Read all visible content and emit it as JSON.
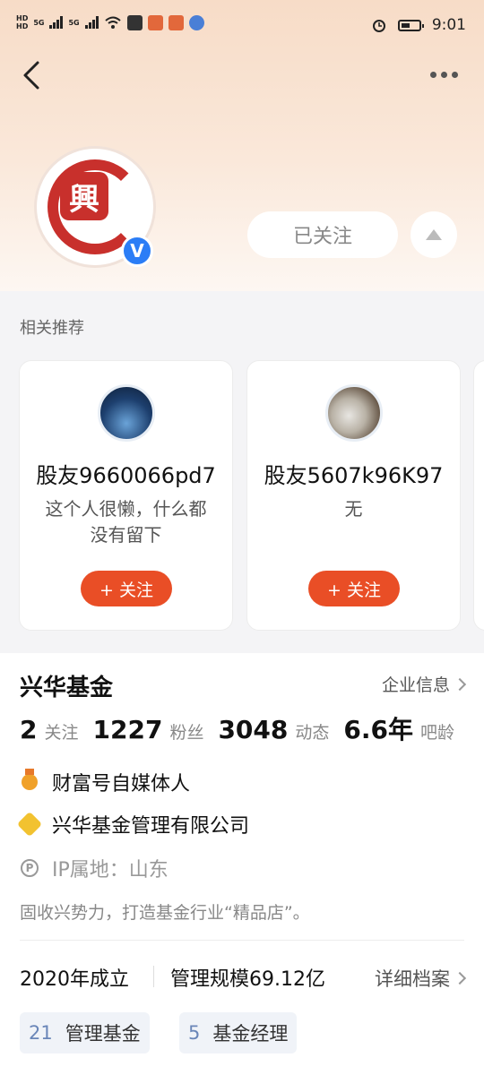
{
  "status_bar": {
    "network_tags": [
      "HD",
      "HD"
    ],
    "signal_labels": [
      "5G",
      "5G"
    ],
    "time": "9:01"
  },
  "header": {
    "back_icon": "chevron-left-icon",
    "more_icon": "more-dots-icon",
    "avatar_glyph": "興",
    "verified_badge": "V",
    "follow_state_label": "已关注",
    "collapse_icon": "triangle-up-icon"
  },
  "recommendations": {
    "title": "相关推荐",
    "cards": [
      {
        "name": "股友9660066pd7",
        "description": "这个人很懒，什么都没有留下",
        "follow_label": "+ 关注"
      },
      {
        "name": "股友5607k96K97",
        "description": "无",
        "follow_label": "+ 关注"
      }
    ]
  },
  "profile": {
    "name": "兴华基金",
    "enterprise_link": "企业信息",
    "stats": [
      {
        "value": "2",
        "label": "关注"
      },
      {
        "value": "1227",
        "label": "粉丝"
      },
      {
        "value": "3048",
        "label": "动态"
      },
      {
        "value": "6.6年",
        "label": "吧龄"
      }
    ],
    "badges": [
      {
        "icon": "medal-icon",
        "text": "财富号自媒体人"
      },
      {
        "icon": "company-badge-icon",
        "text": "兴华基金管理有限公司"
      }
    ],
    "ip_location": "IP属地：山东",
    "bio": "固收兴势力，打造基金行业“精品店”。",
    "founded": "2020年成立",
    "scale": "管理规模69.12亿",
    "detail_link": "详细档案",
    "chips": [
      {
        "count": "21",
        "label": "管理基金"
      },
      {
        "count": "5",
        "label": "基金经理"
      }
    ]
  },
  "colors": {
    "accent": "#e94e26",
    "verified": "#2b7df6",
    "seal_red": "#c8302c"
  }
}
